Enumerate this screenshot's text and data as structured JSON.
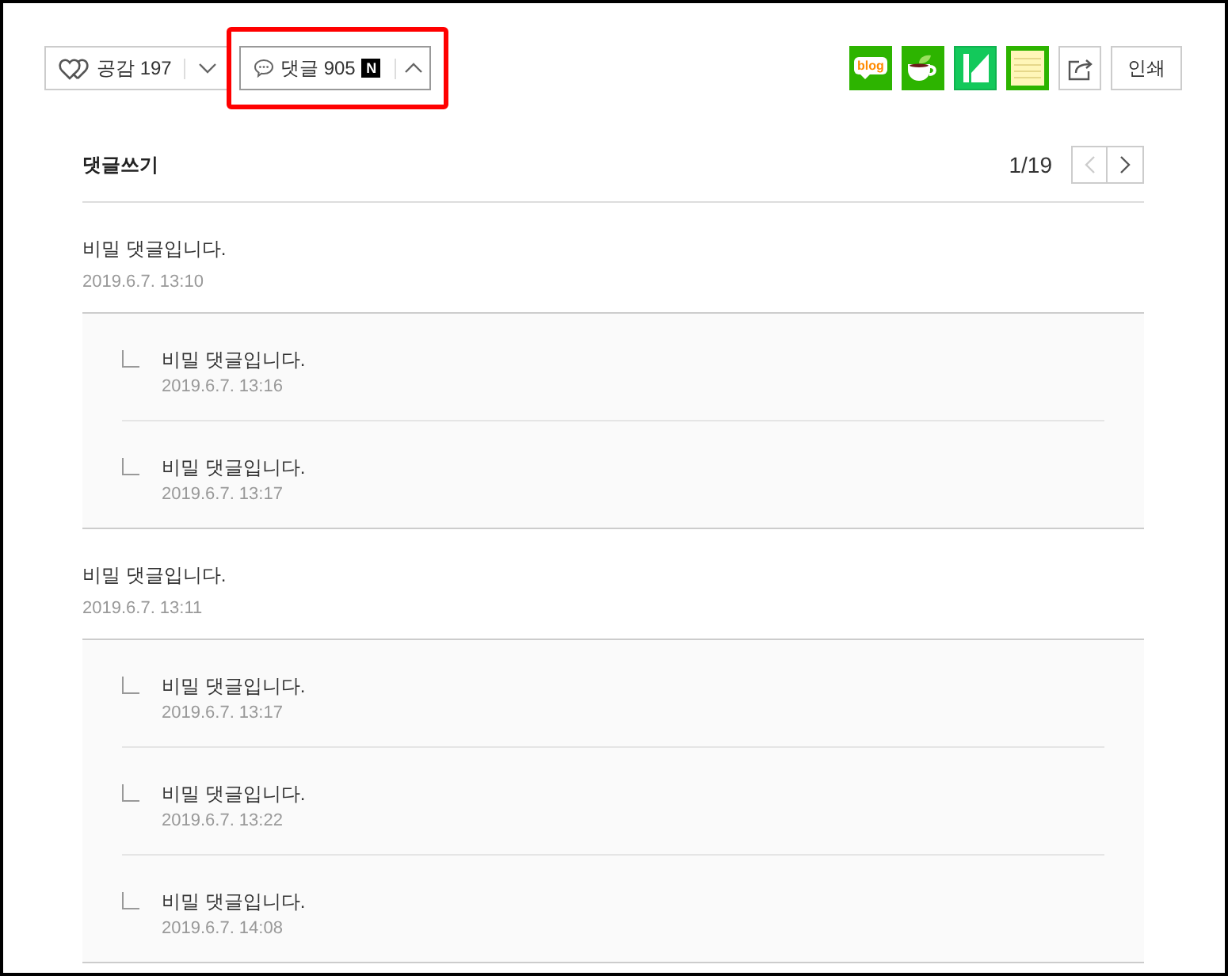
{
  "toolbar": {
    "like_button": {
      "label": "공감",
      "count": "197",
      "expanded": false
    },
    "comment_button": {
      "label": "댓글",
      "count": "905",
      "badge": "N",
      "expanded": true,
      "highlighted": true
    },
    "share_buttons": [
      {
        "kind": "blog",
        "text": "blog"
      },
      {
        "kind": "cafe"
      },
      {
        "kind": "keep"
      },
      {
        "kind": "memo"
      },
      {
        "kind": "share"
      }
    ],
    "print_button": {
      "label": "인쇄"
    }
  },
  "comments": {
    "write_label": "댓글쓰기",
    "pager": {
      "page": "1/19",
      "prev_disabled": true,
      "next_disabled": false
    },
    "threads": [
      {
        "text": "비밀 댓글입니다.",
        "date": "2019.6.7. 13:10",
        "children": [
          {
            "text": "비밀 댓글입니다.",
            "date": "2019.6.7. 13:16"
          },
          {
            "text": "비밀 댓글입니다.",
            "date": "2019.6.7. 13:17"
          }
        ]
      },
      {
        "text": "비밀 댓글입니다.",
        "date": "2019.6.7. 13:11",
        "children": [
          {
            "text": "비밀 댓글입니다.",
            "date": "2019.6.7. 13:17"
          },
          {
            "text": "비밀 댓글입니다.",
            "date": "2019.6.7. 13:22"
          },
          {
            "text": "비밀 댓글입니다.",
            "date": "2019.6.7. 14:08"
          }
        ]
      }
    ]
  }
}
